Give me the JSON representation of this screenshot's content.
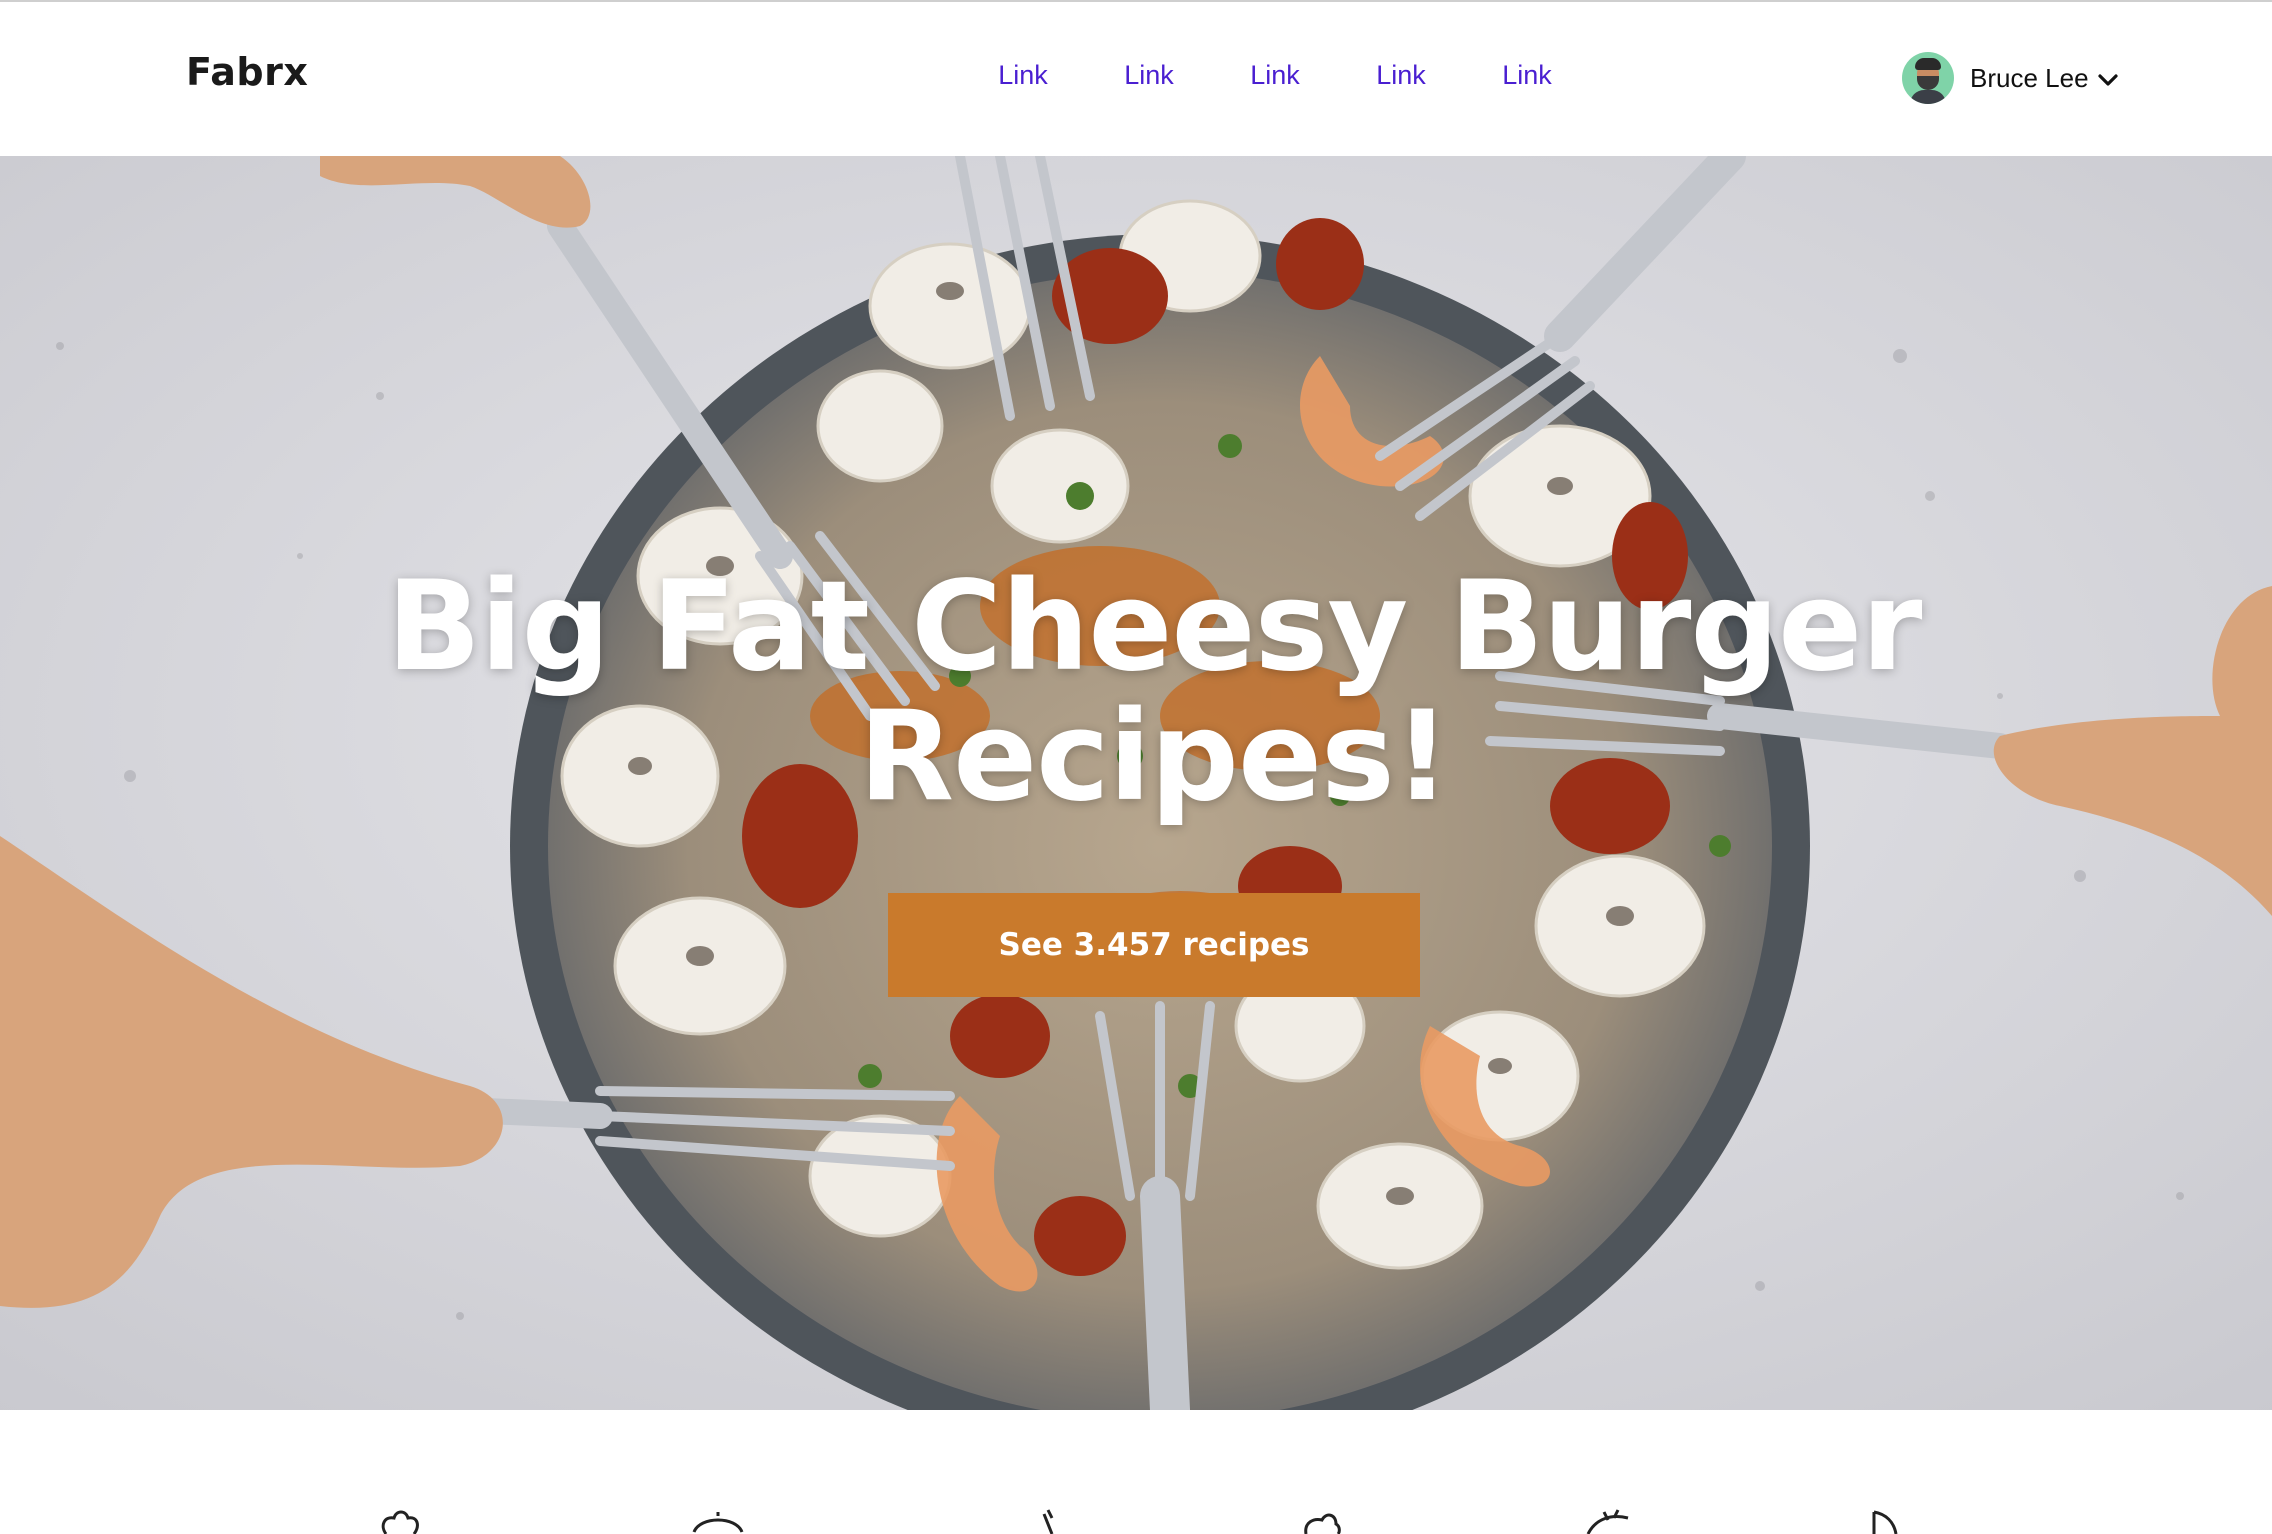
{
  "brand": {
    "name": "Fabrx"
  },
  "nav": {
    "links": [
      {
        "label": "Link"
      },
      {
        "label": "Link"
      },
      {
        "label": "Link"
      },
      {
        "label": "Link"
      },
      {
        "label": "Link"
      }
    ]
  },
  "user": {
    "name": "Bruce Lee",
    "avatar_icon": "user-avatar-icon",
    "menu_icon": "chevron-down-icon"
  },
  "hero": {
    "title": "Big Fat Cheesy Burger Recipes!",
    "cta_label": "See 3.457 recipes",
    "background": "overhead plate of food with forks"
  },
  "categories": {
    "icons": [
      "chef-hat-icon",
      "serving-dish-icon",
      "carrot-icon",
      "cupcake-icon",
      "leaf-icon",
      "pizza-icon"
    ]
  },
  "colors": {
    "link": "#4a1fd1",
    "cta": "#c97a2c",
    "brand_text": "#1a1a1a"
  }
}
